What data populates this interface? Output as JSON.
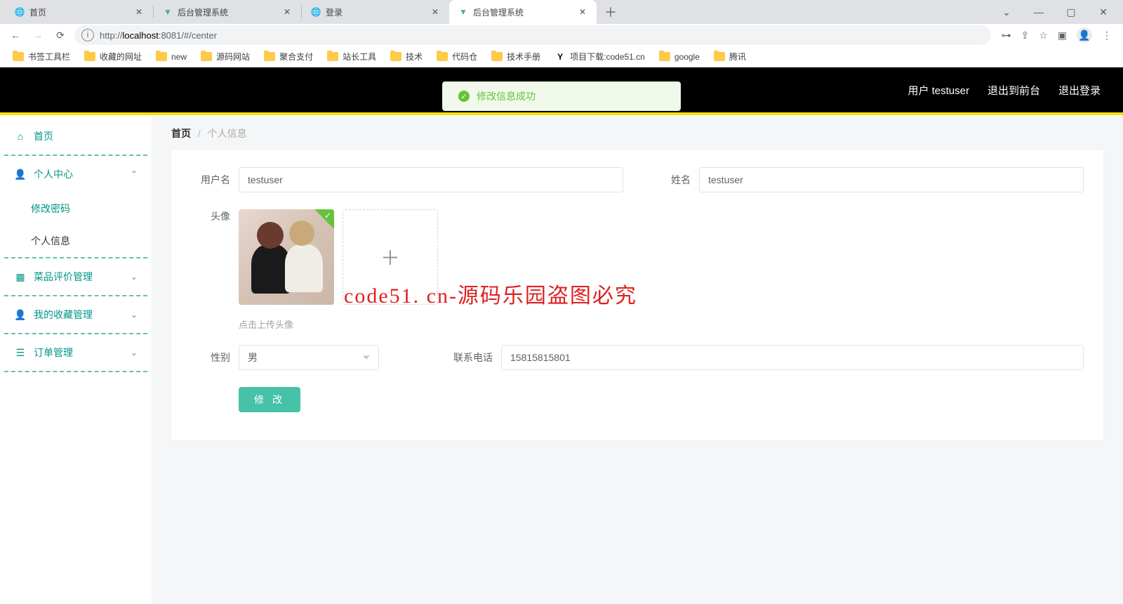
{
  "browser": {
    "tabs": [
      {
        "title": "首页",
        "favicon": "globe"
      },
      {
        "title": "后台管理系统",
        "favicon": "vue"
      },
      {
        "title": "登录",
        "favicon": "globe"
      },
      {
        "title": "后台管理系统",
        "favicon": "vue",
        "active": true
      }
    ],
    "url_prefix": "http://",
    "url_host": "localhost",
    "url_rest": ":8081/#/center",
    "bookmarks": [
      {
        "label": "书签工具栏",
        "icon": "folder"
      },
      {
        "label": "收藏的网址",
        "icon": "folder"
      },
      {
        "label": "new",
        "icon": "folder"
      },
      {
        "label": "源码网站",
        "icon": "folder"
      },
      {
        "label": "聚合支付",
        "icon": "folder"
      },
      {
        "label": "站长工具",
        "icon": "folder"
      },
      {
        "label": "技术",
        "icon": "folder"
      },
      {
        "label": "代码仓",
        "icon": "folder"
      },
      {
        "label": "技术手册",
        "icon": "folder"
      },
      {
        "label": "项目下载:code51.cn",
        "icon": "y"
      },
      {
        "label": "google",
        "icon": "folder"
      },
      {
        "label": "腾讯",
        "icon": "folder"
      }
    ]
  },
  "header": {
    "user_label": "用户 testuser",
    "exit_front": "退出到前台",
    "logout": "退出登录"
  },
  "toast": {
    "text": "修改信息成功"
  },
  "sidebar": {
    "home": "首页",
    "items": [
      {
        "label": "个人中心",
        "expanded": true,
        "children": [
          {
            "label": "修改密码"
          },
          {
            "label": "个人信息",
            "active": true
          }
        ]
      },
      {
        "label": "菜品评价管理"
      },
      {
        "label": "我的收藏管理"
      },
      {
        "label": "订单管理"
      }
    ]
  },
  "breadcrumb": {
    "home": "首页",
    "current": "个人信息"
  },
  "form": {
    "username_label": "用户名",
    "username_value": "testuser",
    "name_label": "姓名",
    "name_value": "testuser",
    "avatar_label": "头像",
    "upload_hint": "点击上传头像",
    "gender_label": "性别",
    "gender_value": "男",
    "phone_label": "联系电话",
    "phone_value": "15815815801",
    "submit": "修 改"
  },
  "watermark": "code51. cn-源码乐园盗图必究"
}
